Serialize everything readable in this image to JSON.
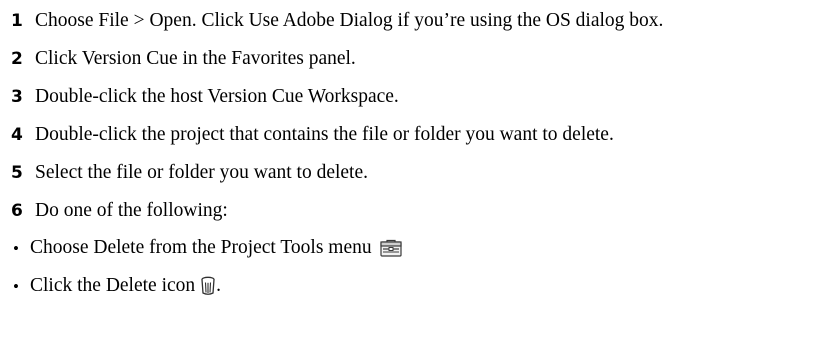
{
  "steps": [
    {
      "number": "1",
      "text": "Choose File > Open. Click Use Adobe Dialog if you’re using the OS dialog box."
    },
    {
      "number": "2",
      "text": "Click Version Cue in the Favorites panel."
    },
    {
      "number": "3",
      "text": "Double-click the host Version Cue Workspace."
    },
    {
      "number": "4",
      "text": "Double-click the project that contains the file or folder you want to delete."
    },
    {
      "number": "5",
      "text": "Select the file or folder you want to delete."
    },
    {
      "number": "6",
      "text": "Do one of the following:"
    }
  ],
  "bullets": [
    {
      "symbol": "•",
      "text": "Choose Delete from the Project Tools menu",
      "icon": "project-tools-menu-icon",
      "tail": ""
    },
    {
      "symbol": "•",
      "text": "Click the Delete icon",
      "icon": "trash-can-icon",
      "tail": "."
    }
  ]
}
